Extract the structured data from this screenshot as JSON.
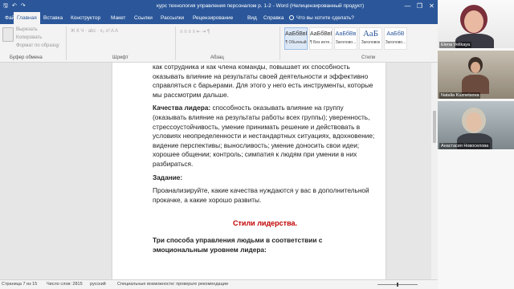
{
  "window": {
    "title": "курс технология управления персоналом р. 1-2  -  Word (Нелицензированный продукт)",
    "minimize": "—",
    "restore": "❐",
    "close": "✕"
  },
  "quick_access": {
    "save_icon": "save-icon",
    "undo_icon": "undo-icon",
    "redo_icon": "redo-icon"
  },
  "tabs": [
    {
      "label": "Файл"
    },
    {
      "label": "Главная"
    },
    {
      "label": "Вставка"
    },
    {
      "label": "Конструктор"
    },
    {
      "label": "Макет"
    },
    {
      "label": "Ссылки"
    },
    {
      "label": "Рассылки"
    },
    {
      "label": "Рецензирование"
    },
    {
      "label": "Вид"
    },
    {
      "label": "Справка"
    }
  ],
  "tell_me": "Что вы хотите сделать?",
  "ribbon": {
    "clipboard": {
      "cut": "Вырезать",
      "copy": "Копировать",
      "format_painter": "Формат по образцу",
      "label": "Буфер обмена"
    },
    "font_label": "Шрифт",
    "paragraph_label": "Абзац",
    "styles_label": "Стили",
    "styles": [
      {
        "sample": "АаБбВвГг,",
        "name": "¶ Обычный"
      },
      {
        "sample": "АаБбВвГг,",
        "name": "¶ Без инте..."
      },
      {
        "sample": "АаБбВв",
        "name": "Заголово..."
      },
      {
        "sample": "АаБ",
        "name": "Заголовок"
      },
      {
        "sample": "АаБбВ",
        "name": "Заголово..."
      }
    ]
  },
  "document": {
    "p1": "как сотрудника и как члена команды, повышает их способность оказывать влияние на результаты своей деятельности и эффективно справляться с барьерами. Для этого у него есть инструменты, которые мы рассмотрим дальше.",
    "p2_bold": "Качества лидера:",
    "p2": " способность оказывать влияние на группу (оказывать влияние на результаты работы всех группы); уверенность, стрессоустойчивость, умение принимать решение и действовать в условиях неопределенности и нестандартных ситуациях, вдохновение; видение перспективы; выносливость; умение доносить свои идеи; хорошее общении; контроль; симпатия к людям при умении в них разбираться.",
    "task": "Задание:",
    "task_text": "Проанализируйте, какие качества нуждаются у вас в дополнительной прокачке, а какие хорошо развиты.",
    "heading": "Стили лидерства.",
    "sub": "Три способа управления людьми в соответствии с эмоциональным уровнем лидера:"
  },
  "status": {
    "page": "Страница 7 из 15",
    "words": "Число слов: 2815",
    "lang": "русский",
    "access": "Специальные возможности: проверьте рекомендации"
  },
  "participants": [
    {
      "name": "Elena Velikaya"
    },
    {
      "name": "Natalia Kuznetsova"
    },
    {
      "name": "Анастасия Новоселова"
    }
  ]
}
